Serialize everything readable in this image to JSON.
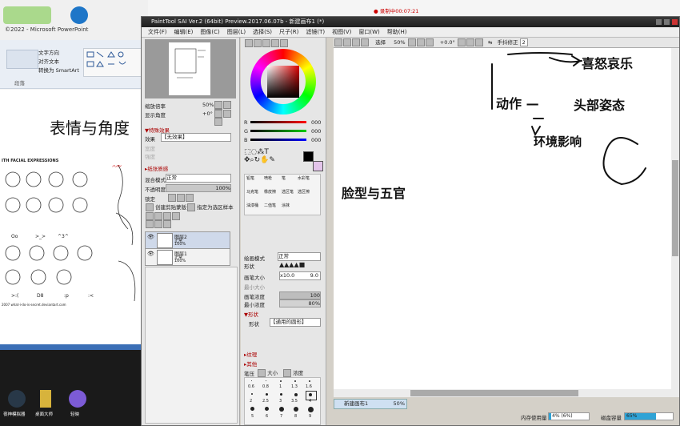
{
  "ppt": {
    "copyright": "©2022 - Microsoft PowerPoint",
    "ribbon_items": [
      "文字方向",
      "对齐文本",
      "转换为 SmartArt"
    ],
    "ribbon_group": "段落",
    "slide_title": "表情与角度",
    "slide_caption": "ITH FACIAL EXPRESSIONS",
    "expression_labels": [
      "Oo",
      ">_>",
      "^3^",
      ">:(",
      "D8",
      ":p",
      ":<"
    ],
    "credit": "2007 what-i-do-is-secret.deviantart.com",
    "taskbar_apps": [
      "夜神模拟器",
      "桌面大师",
      "轻映"
    ]
  },
  "recording": "● 录制中00:07:21",
  "sai": {
    "title": "PaintTool SAI Ver.2 (64bit) Preview.2017.06.07b - 新建画布1 (*)",
    "menu": [
      "文件(F)",
      "编辑(E)",
      "图像(C)",
      "图层(L)",
      "选择(S)",
      "尺子(R)",
      "滤镜(T)",
      "视图(V)",
      "窗口(W)",
      "帮助(H)"
    ],
    "toolbar": {
      "selection_label": "选择",
      "zoom": "50%",
      "rotation": "+0.0°",
      "stabilizer_label": "手抖修正",
      "stabilizer_value": "2"
    },
    "navigator": {
      "zoom_label": "缩放倍率",
      "zoom_value": "50%",
      "angle_label": "显示角度",
      "angle_value": "+0°"
    },
    "effects": {
      "special_title": "▼特殊效果",
      "effect_label": "效果",
      "effect_value": "【无效果】",
      "width_label": "宽度",
      "strength_label": "强度",
      "texture_title": "▸纸张质感"
    },
    "blend": {
      "mode_label": "混合模式",
      "mode_value": "正常",
      "opacity_label": "不透明度",
      "opacity_value": "100%",
      "lock_label": "锁定",
      "clip_label": "创建剪贴蒙版",
      "ref_label": "指定为选区样本"
    },
    "layers": [
      {
        "name": "图层2",
        "mode": "正常",
        "opacity": "100%"
      },
      {
        "name": "图层1",
        "mode": "正常",
        "opacity": "100%"
      }
    ],
    "color": {
      "r_label": "R",
      "r_value": "000",
      "g_label": "G",
      "g_value": "000",
      "b_label": "B",
      "b_value": "000"
    },
    "brush_tools": [
      "铅笔",
      "喷枪",
      "笔",
      "水彩笔",
      "马克笔",
      "橡皮擦",
      "选区笔",
      "选区擦",
      "油漆桶",
      "二值笔",
      "涂抹"
    ],
    "brush": {
      "blend_label": "绘画模式",
      "blend_value": "正常",
      "shape_label": "形状",
      "size_label": "画笔大小",
      "size_mult": "x10.0",
      "size_value": "9.0",
      "min_size_label": "最小大小",
      "density_label": "画笔浓度",
      "density_value": "100",
      "min_density_label": "最小浓度",
      "min_density_value": "80%",
      "shape_section": "▼形状",
      "shape_type_label": "形状",
      "shape_type_value": "【通用的圆形】",
      "texture_section": "▸纹理",
      "other_section": "▸其他",
      "pressure_label": "笔压",
      "pressure_size": "大小",
      "pressure_density": "浓度"
    },
    "brush_sizes": [
      "0.6",
      "0.8",
      "1",
      "1.3",
      "1.6",
      "2",
      "2.5",
      "3",
      "3.5",
      "4",
      "5",
      "6",
      "7",
      "8",
      "9"
    ],
    "canvas_notes": [
      "喜怒哀乐",
      "动作 —",
      "头部姿态",
      "环境影响",
      "脸型与五官"
    ],
    "status": {
      "doc_name": "新建画布1",
      "doc_zoom": "50%",
      "mem_label": "内存使用量",
      "mem_value": "4% (6%)",
      "disk_label": "磁盘容量",
      "disk_value": "65%"
    }
  }
}
